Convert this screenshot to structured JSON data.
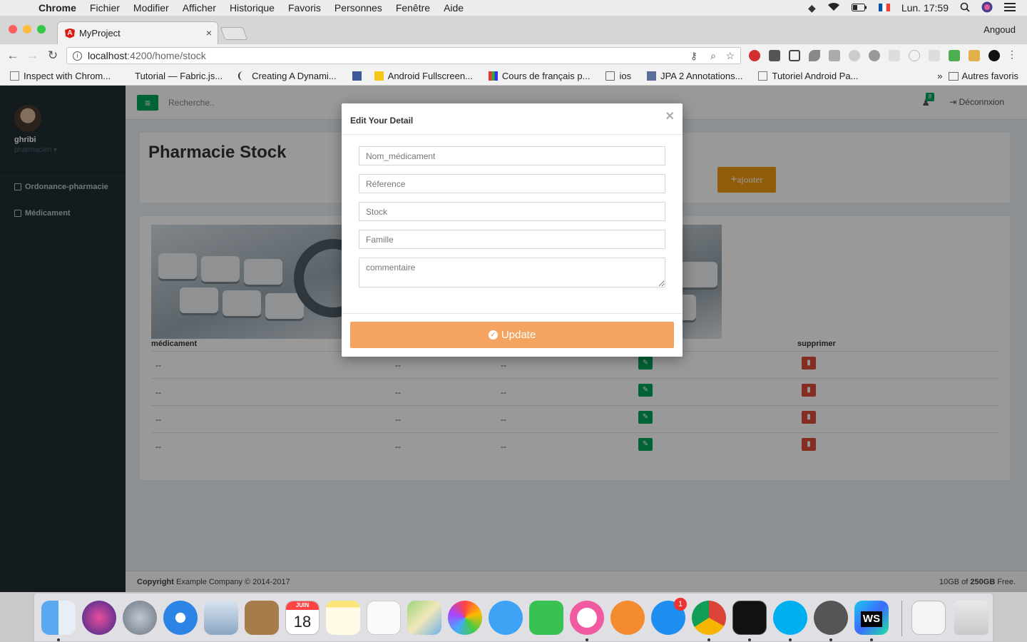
{
  "menubar": {
    "apple": "",
    "items": [
      "Chrome",
      "Fichier",
      "Modifier",
      "Afficher",
      "Historique",
      "Favoris",
      "Personnes",
      "Fenêtre",
      "Aide"
    ],
    "clock": "Lun. 17:59"
  },
  "browser": {
    "tab_title": "MyProject",
    "tab_close": "×",
    "profile": "Angoud",
    "url_host": "localhost",
    "url_path": ":4200/home/stock",
    "bookmarks": [
      {
        "label": "Inspect with Chrom..."
      },
      {
        "label": "Tutorial — Fabric.js..."
      },
      {
        "label": "Creating A Dynami..."
      },
      {
        "label": ""
      },
      {
        "label": "Android Fullscreen..."
      },
      {
        "label": "Cours de français p..."
      },
      {
        "label": "ios"
      },
      {
        "label": "JPA 2 Annotations..."
      },
      {
        "label": "Tutoriel Android Pa..."
      }
    ],
    "bookmarks_more": "»",
    "other_bookmarks": "Autres favoris"
  },
  "sidebar": {
    "user_name": "ghribi",
    "user_role": "pharmacien ▾",
    "items": [
      {
        "label": "Ordonance-pharmacie"
      },
      {
        "label": "Médicament"
      }
    ]
  },
  "topbar": {
    "menu_icon": "≡",
    "search_placeholder": "Recherche..",
    "notif_count": "8",
    "logout": "Déconnxion"
  },
  "content": {
    "title": "Pharmacie Stock",
    "add_button": "ajouter",
    "columns": [
      "médicament",
      "supprimer"
    ],
    "rows": [
      {
        "c1": "--",
        "c2": "--",
        "c3": "--"
      },
      {
        "c1": "--",
        "c2": "--",
        "c3": "--"
      },
      {
        "c1": "--",
        "c2": "--",
        "c3": "--"
      },
      {
        "c1": "--",
        "c2": "--",
        "c3": "--"
      }
    ]
  },
  "footer": {
    "copyright_strong": "Copyright",
    "copyright_rest": " Example Company © 2014-2017",
    "storage_pre": "10GB of ",
    "storage_strong": "250GB",
    "storage_post": " Free."
  },
  "modal": {
    "title": "Edit Your Detail",
    "close": "×",
    "fields": [
      {
        "placeholder": "Nom_médicament",
        "value": ""
      },
      {
        "placeholder": "Réference",
        "value": ""
      },
      {
        "placeholder": "Stock",
        "value": ""
      },
      {
        "placeholder": "Famille",
        "value": ""
      }
    ],
    "comment_placeholder": "commentaire",
    "update_label": "Update"
  },
  "dock": {
    "calendar_month": "JUIN",
    "calendar_day": "18",
    "appstore_badge": "1",
    "webstorm_label": "WS"
  },
  "colors": {
    "sidebar": "#222d32",
    "green": "#00a65a",
    "orange": "#f39c12",
    "update": "#f4a460",
    "red": "#dd4b39"
  }
}
